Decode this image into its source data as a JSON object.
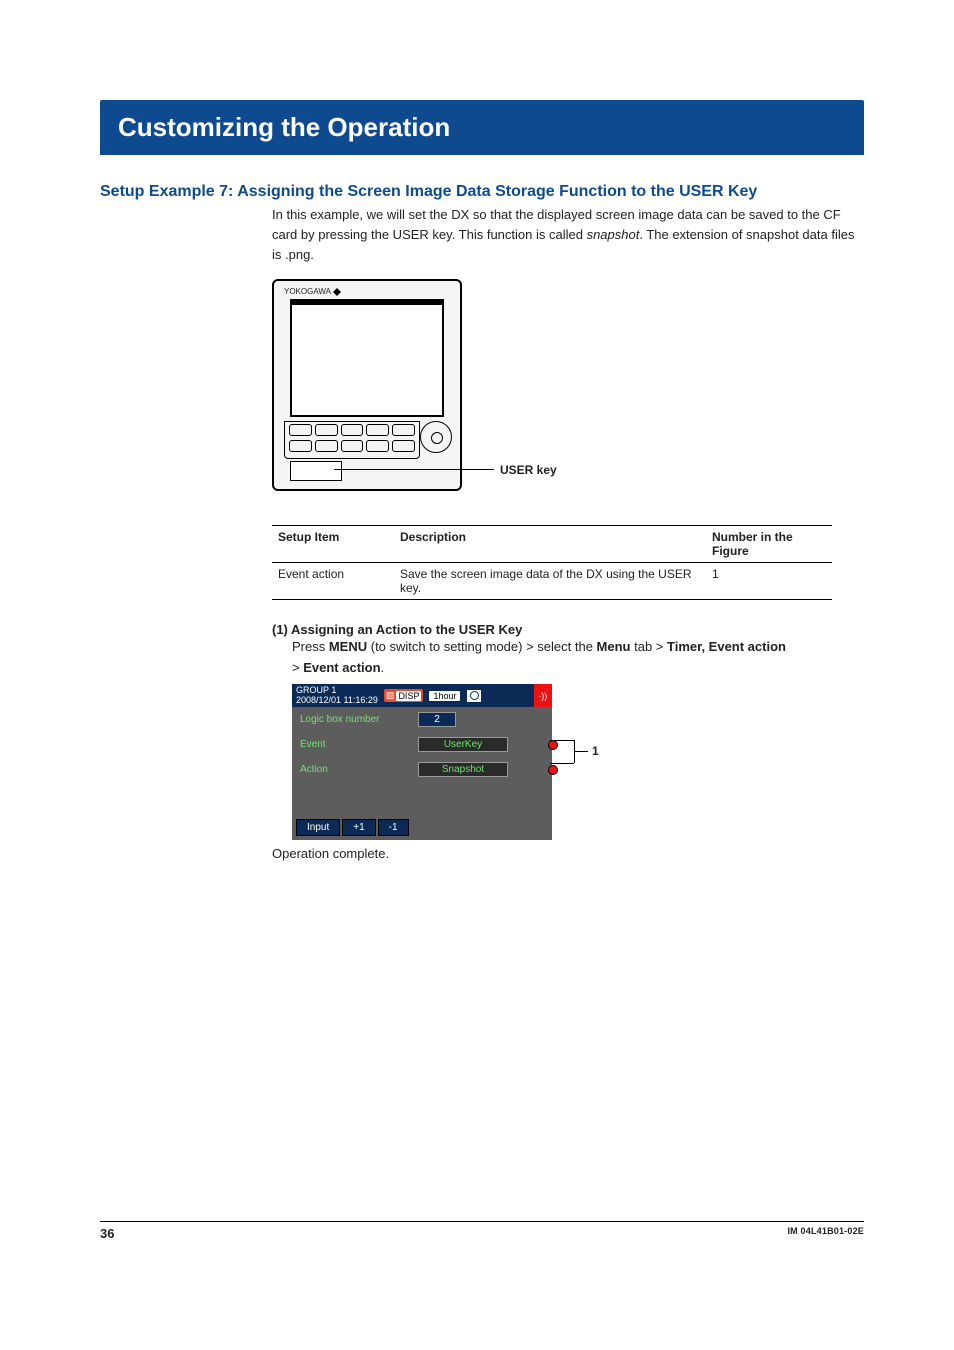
{
  "banner": "Customizing the Operation",
  "section_title": "Setup Example 7: Assigning the Screen Image Data Storage Function to the USER Key",
  "intro": {
    "p1a": "In this example, we will set the DX so that the displayed screen image data can be saved to the CF card by pressing the USER key. This function is called ",
    "p1em": "snapshot",
    "p1b": ". The extension of snapshot data files is .png."
  },
  "device": {
    "brand": "YOKOGAWA",
    "label": "USER key"
  },
  "table": {
    "headers": [
      "Setup Item",
      "Description",
      "Number in the Figure"
    ],
    "rows": [
      {
        "item": "Event action",
        "desc": "Save the screen image data of the DX using the USER key.",
        "num": "1"
      }
    ]
  },
  "step1": {
    "title": "(1) Assigning an Action to the USER Key",
    "l1a": "Press ",
    "l1b": "MENU",
    "l1c": " (to switch to setting mode) > select the ",
    "l1d": "Menu",
    "l1e": " tab > ",
    "l1f": "Timer, Event action",
    "l2a": "> ",
    "l2b": "Event action",
    "l2c": "."
  },
  "screenshot": {
    "title_group": "GROUP 1",
    "title_ts": "2008/12/01 11:16:29",
    "disp": "DISP",
    "indicator": "1hour",
    "rows": {
      "logic_lbl": "Logic box number",
      "logic_val": "2",
      "event_lbl": "Event",
      "event_val": "UserKey",
      "action_lbl": "Action",
      "action_val": "Snapshot"
    },
    "footer": {
      "input": "Input",
      "plus": "+1",
      "minus": "-1"
    }
  },
  "callout1": "1",
  "op_complete": "Operation complete.",
  "footer": {
    "page": "36",
    "doc": "IM 04L41B01-02E"
  }
}
